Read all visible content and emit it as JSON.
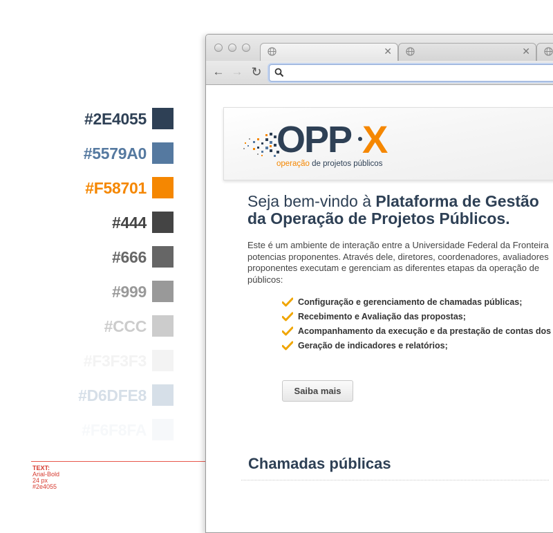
{
  "palette": [
    {
      "label": "#2E4055",
      "color": "#2e4055"
    },
    {
      "label": "#5579A0",
      "color": "#5579a0"
    },
    {
      "label": "#F58701",
      "color": "#f58701"
    },
    {
      "label": "#444",
      "color": "#444444"
    },
    {
      "label": "#666",
      "color": "#666666"
    },
    {
      "label": "#999",
      "color": "#999999"
    },
    {
      "label": "#CCC",
      "color": "#cccccc"
    },
    {
      "label": "#F3F3F3",
      "color": "#f3f3f3"
    },
    {
      "label": "#D6DFE8",
      "color": "#d6dfe8"
    },
    {
      "label": "#F6F8FA",
      "color": "#f6f8fa"
    }
  ],
  "annotation": {
    "title": "TEXT:",
    "font": "Arial-Bold",
    "size": "24 px",
    "color": "#2e4055"
  },
  "browser": {
    "url_value": "",
    "url_placeholder": ""
  },
  "logo": {
    "text_opp": "OPP",
    "text_x": "X",
    "tagline_accent": "operação",
    "tagline_rest": " de projetos públicos"
  },
  "welcome": {
    "prefix": "Seja bem-vindo à ",
    "bold_line1": "Plataforma de Gestão",
    "bold_line2": "da Operação de Projetos Públicos."
  },
  "intro_lines": [
    "Este é um ambiente de interação entre a Universidade Federal da Fronteira",
    "potencias proponentes. Através dele, diretores, coordenadores, avaliadores",
    "proponentes executam e gerenciam as diferentes etapas da operação de",
    "públicos:"
  ],
  "features": [
    "Configuração e gerenciamento de chamadas públicas;",
    "Recebimento e Avaliação das propostas;",
    "Acompanhamento da execução e da prestação de contas dos",
    "Geração de indicadores e relatórios;"
  ],
  "more_button": "Saiba mais",
  "section_title": "Chamadas públicas",
  "colors": {
    "primary": "#2e4055",
    "secondary": "#5579a0",
    "accent": "#f58701",
    "annotation": "#d63a2f",
    "check": "#f0a500"
  },
  "icons": [
    "globe-icon",
    "close-icon",
    "back-icon",
    "forward-icon",
    "reload-icon",
    "search-icon",
    "check-icon"
  ]
}
